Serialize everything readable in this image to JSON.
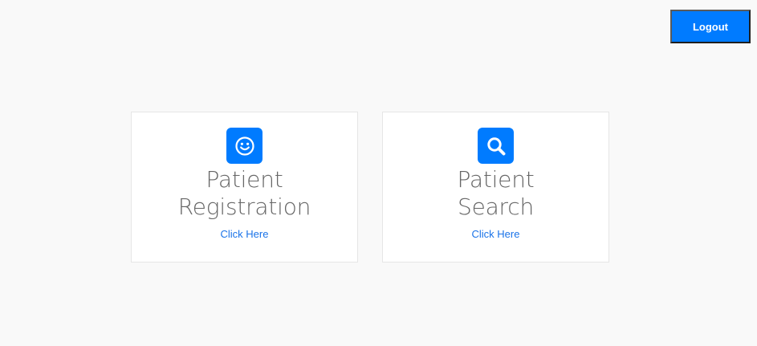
{
  "header": {
    "logout_label": "Logout"
  },
  "cards": [
    {
      "title_line1": "Patient",
      "title_line2": "Registration",
      "link_label": "Click Here",
      "icon": "smiley-icon"
    },
    {
      "title_line1": "Patient",
      "title_line2": "Search",
      "link_label": "Click Here",
      "icon": "search-icon"
    }
  ],
  "colors": {
    "accent": "#007bff",
    "background": "#f9f9f9",
    "card_background": "#ffffff",
    "title_text": "#666666",
    "link_text": "#1a73e8"
  }
}
